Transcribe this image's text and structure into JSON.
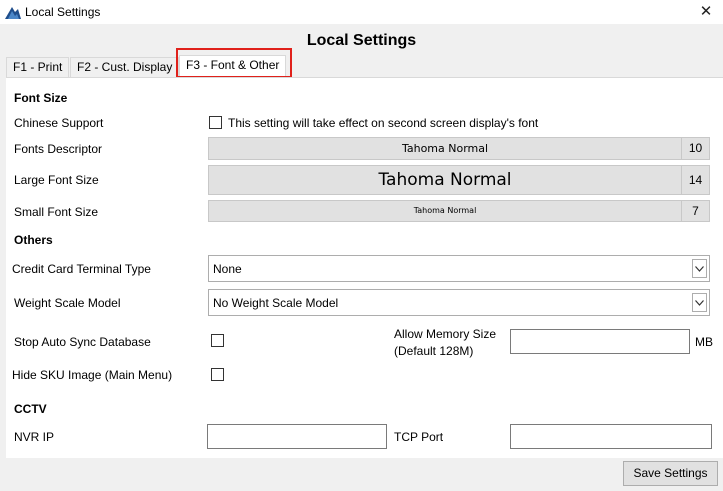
{
  "window": {
    "title": "Local Settings",
    "close_glyph": "✕"
  },
  "heading": "Local Settings",
  "tabs": [
    {
      "label": "F1 - Print"
    },
    {
      "label": "F2 - Cust. Display"
    },
    {
      "label": "F3 - Font & Other"
    }
  ],
  "font_size_section": {
    "title": "Font Size",
    "chinese_support": {
      "label": "Chinese Support",
      "checkbox_text": "This setting will take effect on second screen display's font",
      "checked": false
    },
    "fonts_descriptor": {
      "label": "Fonts Descriptor",
      "font_name": "Tahoma Normal",
      "size": "10"
    },
    "large_font": {
      "label": "Large Font Size",
      "font_name": "Tahoma Normal",
      "size": "14"
    },
    "small_font": {
      "label": "Small Font Size",
      "font_name": "Tahoma Normal",
      "size": "7"
    }
  },
  "others_section": {
    "title": "Others",
    "credit_card_terminal": {
      "label": "Credit Card Terminal Type",
      "value": "None"
    },
    "weight_scale": {
      "label": "Weight Scale Model",
      "value": "No Weight Scale Model"
    },
    "stop_auto_sync": {
      "label": "Stop Auto Sync Database",
      "checked": false
    },
    "allow_memory": {
      "label_line1": "Allow Memory Size",
      "label_line2": "(Default 128M)",
      "value": "",
      "unit": "MB"
    },
    "hide_sku_image": {
      "label": "Hide SKU Image (Main Menu)",
      "checked": false
    }
  },
  "cctv_section": {
    "title": "CCTV",
    "nvr_ip": {
      "label": "NVR IP",
      "value": ""
    },
    "tcp_port": {
      "label": "TCP Port",
      "value": ""
    }
  },
  "footer": {
    "save_label": "Save Settings"
  },
  "colors": {
    "highlight": "#e0211b",
    "panel_bg": "#ffffff",
    "window_bg": "#f0f0f0"
  }
}
